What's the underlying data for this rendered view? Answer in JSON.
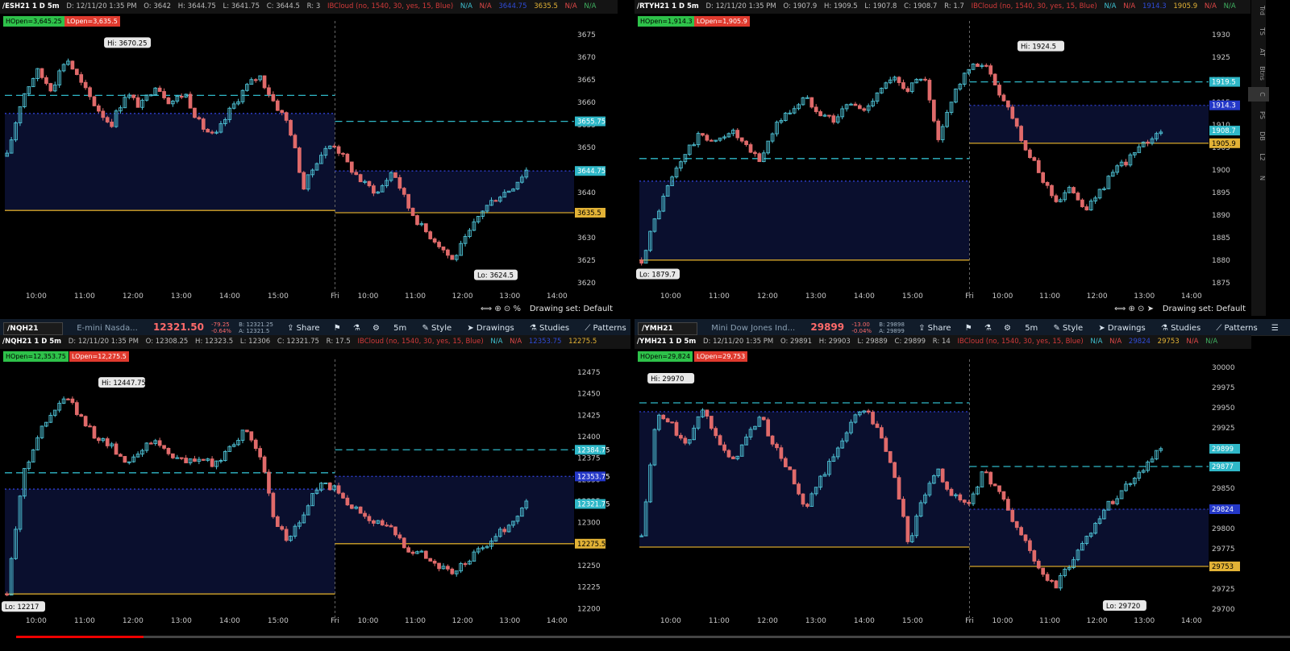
{
  "panels": [
    {
      "id": "es",
      "symbol": "/ESH21 1 D 5m",
      "header_stats": [
        "D: 12/11/20 1:35 PM",
        "O: 3642",
        "H: 3644.75",
        "L: 3641.75",
        "C: 3644.5",
        "R: 3"
      ],
      "study_text": "IBCloud (no, 1540, 30, yes, 15, Blue)",
      "na_labels": [
        "N/A",
        "N/A",
        "N/A",
        "3635.5",
        "N/A",
        "N/A"
      ],
      "hopen": "HOpen=3,645.25",
      "lopen": "LOpen=3,635.5",
      "hi_label": "Hi: 3670.25",
      "lo_label": "Lo: 3624.5",
      "price_labels": [
        "3655.75",
        "3644.75",
        "3635.5"
      ],
      "footer": "Drawing set: Default",
      "chart_data": {
        "type": "candlestick",
        "ylim": [
          3618,
          3678
        ],
        "y_ticks": [
          3620,
          3625,
          3630,
          3635,
          3640,
          3645,
          3650,
          3655,
          3660,
          3665,
          3670,
          3675
        ],
        "x_ticks": [
          "10:00",
          "11:00",
          "12:00",
          "13:00",
          "14:00",
          "15:00",
          "Fri",
          "10:00",
          "11:00",
          "12:00",
          "13:00",
          "14:00"
        ],
        "day_split_fraction": 0.58,
        "path": [
          3648,
          3661,
          3667,
          3663,
          3670,
          3664,
          3659,
          3655,
          3662,
          3659,
          3664,
          3660,
          3662,
          3655,
          3652,
          3658,
          3663,
          3666,
          3660,
          3655,
          3641,
          3648,
          3651,
          3646,
          3642,
          3640,
          3645,
          3637,
          3632,
          3629,
          3625,
          3630,
          3636,
          3639,
          3641,
          3645
        ],
        "last_bar_fraction": 0.92,
        "levels": [
          {
            "value": 3661.5,
            "to": 0.58,
            "color": "#2fb8c8",
            "style": "dash"
          },
          {
            "value": 3655.75,
            "from": 0.58,
            "color": "#2fb8c8",
            "style": "dash"
          },
          {
            "value": 3644.75,
            "from": 0.58,
            "color": "#2f3fd0",
            "style": "dot"
          },
          {
            "value": 3657.5,
            "to": 0.58,
            "color": "#2f3fd0",
            "style": "dot"
          },
          {
            "value": 3636,
            "to": 0.58,
            "color": "#d4a52a",
            "style": "solid"
          },
          {
            "value": 3635.5,
            "from": 0.58,
            "color": "#d4a52a",
            "style": "solid"
          }
        ],
        "price_boxes": [
          {
            "value": 3655.75,
            "bg": "#2fb8c8",
            "fg": "#fff"
          },
          {
            "value": 3644.75,
            "bg": "#2fb8c8",
            "fg": "#fff"
          },
          {
            "value": 3635.5,
            "bg": "#e2b236",
            "fg": "#000"
          }
        ],
        "hi": {
          "value": 3670.25,
          "at": 0.18
        },
        "lo": {
          "value": 3624.5,
          "at": 0.83
        }
      }
    },
    {
      "id": "rty",
      "symbol": "/RTYH21 1 D 5m",
      "header_stats": [
        "D: 12/11/20 1:35 PM",
        "O: 1907.9",
        "H: 1909.5",
        "L: 1907.8",
        "C: 1908.7",
        "R: 1.7"
      ],
      "study_text": "IBCloud (no, 1540, 30, yes, 15, Blue)",
      "na_labels": [
        "N/A",
        "N/A",
        "N/A",
        "1905.9",
        "N/A",
        "N/A"
      ],
      "hopen": "HOpen=1,914.3",
      "lopen": "LOpen=1,905.9",
      "hi_label": "Hi: 1924.5",
      "lo_label": "Lo: 1879.7",
      "price_labels": [
        "1919.5",
        "1914.3",
        "1908.7",
        "1905.9"
      ],
      "footer": "Drawing set: Default",
      "chart_data": {
        "type": "candlestick",
        "ylim": [
          1873,
          1933
        ],
        "y_ticks": [
          1875,
          1880,
          1885,
          1890,
          1895,
          1900,
          1905,
          1910,
          1915,
          1920,
          1925,
          1930
        ],
        "x_ticks": [
          "10:00",
          "11:00",
          "12:00",
          "13:00",
          "14:00",
          "15:00",
          "Fri",
          "10:00",
          "11:00",
          "12:00",
          "13:00",
          "14:00"
        ],
        "day_split_fraction": 0.58,
        "path": [
          1880,
          1890,
          1898,
          1904,
          1908,
          1906,
          1909,
          1905,
          1902,
          1910,
          1913,
          1916,
          1913,
          1911,
          1915,
          1913,
          1918,
          1920,
          1918,
          1921,
          1906,
          1917,
          1922,
          1924,
          1918,
          1912,
          1904,
          1898,
          1893,
          1896,
          1891,
          1896,
          1900,
          1903,
          1906,
          1909
        ],
        "last_bar_fraction": 0.92,
        "levels": [
          {
            "value": 1902.5,
            "to": 0.58,
            "color": "#2fb8c8",
            "style": "dash"
          },
          {
            "value": 1919.5,
            "from": 0.58,
            "color": "#2fb8c8",
            "style": "dash"
          },
          {
            "value": 1914.3,
            "from": 0.58,
            "color": "#2f3fd0",
            "style": "dot"
          },
          {
            "value": 1897.5,
            "to": 0.58,
            "color": "#2f3fd0",
            "style": "dot"
          },
          {
            "value": 1880,
            "to": 0.58,
            "color": "#d4a52a",
            "style": "solid"
          },
          {
            "value": 1905.9,
            "from": 0.58,
            "color": "#d4a52a",
            "style": "solid"
          }
        ],
        "price_boxes": [
          {
            "value": 1919.5,
            "bg": "#2fb8c8",
            "fg": "#fff"
          },
          {
            "value": 1914.3,
            "bg": "#2438c8",
            "fg": "#fff"
          },
          {
            "value": 1908.7,
            "bg": "#2fb8c8",
            "fg": "#fff"
          },
          {
            "value": 1905.9,
            "bg": "#e2b236",
            "fg": "#000"
          }
        ],
        "hi": {
          "value": 1924.5,
          "at": 0.67
        },
        "lo": {
          "value": 1879.7,
          "at": 0.0
        }
      }
    },
    {
      "id": "nq",
      "toolbar": {
        "symbol": "/NQH21",
        "desc": "E-mini Nasda...",
        "price": "12321.50",
        "change_a": "-79.25",
        "change_b": "-0.64%",
        "bid": "B: 12321.25",
        "ask": "A: 12321.5"
      },
      "symbol": "/NQH21 1 D 5m",
      "header_stats": [
        "D: 12/11/20 1:35 PM",
        "O: 12308.25",
        "H: 12323.5",
        "L: 12306",
        "C: 12321.75",
        "R: 17.5"
      ],
      "study_text": "IBCloud (no, 1540, 30, yes, 15, Blue)",
      "na_labels": [
        "N/A",
        "N/A",
        "N/A",
        "12275.5",
        "",
        ""
      ],
      "hopen": "HOpen=12,353.75",
      "lopen": "LOpen=12,275.5",
      "hi_label": "Hi: 12447.75",
      "lo_label": "Lo: 12217",
      "price_labels": [
        "12384.75",
        "12353.75",
        "12321.75",
        "12275.5"
      ],
      "chart_data": {
        "type": "candlestick",
        "ylim": [
          12190,
          12490
        ],
        "y_ticks": [
          12200,
          12225,
          12250,
          12275,
          12300,
          12325,
          12350,
          12375,
          12400,
          12425,
          12450,
          12475
        ],
        "x_ticks": [
          "10:00",
          "11:00",
          "12:00",
          "13:00",
          "14:00",
          "15:00",
          "Fri",
          "10:00",
          "11:00",
          "12:00",
          "13:00",
          "14:00"
        ],
        "day_split_fraction": 0.58,
        "path": [
          12217,
          12350,
          12400,
          12425,
          12447,
          12420,
          12400,
          12390,
          12370,
          12385,
          12395,
          12380,
          12370,
          12375,
          12365,
          12390,
          12405,
          12385,
          12300,
          12280,
          12310,
          12345,
          12340,
          12320,
          12310,
          12300,
          12290,
          12270,
          12265,
          12250,
          12240,
          12255,
          12270,
          12285,
          12300,
          12322
        ],
        "last_bar_fraction": 0.92,
        "levels": [
          {
            "value": 12358,
            "to": 0.58,
            "color": "#2fb8c8",
            "style": "dash"
          },
          {
            "value": 12384.75,
            "from": 0.58,
            "color": "#2fb8c8",
            "style": "dash"
          },
          {
            "value": 12353.75,
            "from": 0.58,
            "color": "#2f3fd0",
            "style": "dot"
          },
          {
            "value": 12339,
            "to": 0.58,
            "color": "#2f3fd0",
            "style": "dot"
          },
          {
            "value": 12217,
            "to": 0.58,
            "color": "#d4a52a",
            "style": "solid"
          },
          {
            "value": 12275.5,
            "from": 0.58,
            "color": "#d4a52a",
            "style": "solid"
          }
        ],
        "price_boxes": [
          {
            "value": 12384.75,
            "bg": "#2fb8c8",
            "fg": "#fff"
          },
          {
            "value": 12353.75,
            "bg": "#2438c8",
            "fg": "#fff"
          },
          {
            "value": 12321.75,
            "bg": "#2fb8c8",
            "fg": "#fff"
          },
          {
            "value": 12275.5,
            "bg": "#e2b236",
            "fg": "#000"
          }
        ],
        "hi": {
          "value": 12447.75,
          "at": 0.17
        },
        "lo": {
          "value": 12217,
          "at": 0.0
        }
      }
    },
    {
      "id": "ym",
      "toolbar": {
        "symbol": "/YMH21",
        "desc": "Mini Dow Jones Ind...",
        "price": "29899",
        "change_a": "-13.00",
        "change_b": "-0.04%",
        "bid": "B: 29898",
        "ask": "A: 29899"
      },
      "symbol": "/YMH21 1 D 5m",
      "header_stats": [
        "D: 12/11/20 1:35 PM",
        "O: 29891",
        "H: 29903",
        "L: 29889",
        "C: 29899",
        "R: 14"
      ],
      "study_text": "IBCloud (no, 1540, 30, yes, 15, Blue)",
      "na_labels": [
        "N/A",
        "N/A",
        "N/A",
        "29753",
        "N/A",
        "N/A"
      ],
      "hopen": "HOpen=29,824",
      "lopen": "LOpen=29,753",
      "hi_label": "Hi: 29970",
      "lo_label": "Lo: 29720",
      "price_labels": [
        "29899",
        "29877",
        "29824",
        "29753"
      ],
      "chart_data": {
        "type": "candlestick",
        "ylim": [
          29690,
          30010
        ],
        "y_ticks": [
          29700,
          29725,
          29750,
          29775,
          29800,
          29825,
          29850,
          29875,
          29900,
          29925,
          29950,
          29975,
          30000
        ],
        "x_ticks": [
          "10:00",
          "11:00",
          "12:00",
          "13:00",
          "14:00",
          "15:00",
          "Fri",
          "10:00",
          "11:00",
          "12:00",
          "13:00",
          "14:00"
        ],
        "day_split_fraction": 0.58,
        "path": [
          29790,
          29940,
          29930,
          29900,
          29950,
          29920,
          29880,
          29910,
          29940,
          29900,
          29870,
          29820,
          29860,
          29890,
          29930,
          29950,
          29920,
          29870,
          29780,
          29840,
          29870,
          29840,
          29830,
          29870,
          29850,
          29810,
          29780,
          29740,
          29730,
          29760,
          29790,
          29820,
          29840,
          29860,
          29880,
          29899
        ],
        "last_bar_fraction": 0.92,
        "levels": [
          {
            "value": 29956,
            "to": 0.58,
            "color": "#2fb8c8",
            "style": "dash"
          },
          {
            "value": 29877,
            "from": 0.58,
            "color": "#2fb8c8",
            "style": "dash"
          },
          {
            "value": 29824,
            "from": 0.58,
            "color": "#2f3fd0",
            "style": "dot"
          },
          {
            "value": 29945,
            "to": 0.58,
            "color": "#2f3fd0",
            "style": "dot"
          },
          {
            "value": 29777,
            "to": 0.58,
            "color": "#d4a52a",
            "style": "solid"
          },
          {
            "value": 29753,
            "from": 0.58,
            "color": "#d4a52a",
            "style": "solid"
          }
        ],
        "price_boxes": [
          {
            "value": 29899,
            "bg": "#2fb8c8",
            "fg": "#fff"
          },
          {
            "value": 29877,
            "bg": "#2fb8c8",
            "fg": "#fff"
          },
          {
            "value": 29824,
            "bg": "#2438c8",
            "fg": "#fff"
          },
          {
            "value": 29753,
            "bg": "#e2b236",
            "fg": "#000"
          }
        ],
        "hi": {
          "value": 29970,
          "at": 0.02
        },
        "lo": {
          "value": 29720,
          "at": 0.82
        }
      }
    }
  ],
  "toolbar_buttons": {
    "share": "Share",
    "timeframe": "5m",
    "style": "Style",
    "drawings": "Drawings",
    "studies": "Studies",
    "patterns": "Patterns"
  },
  "side_tabs": [
    "Trd",
    "TS",
    "AT",
    "Btns",
    "C",
    "PS",
    "DB",
    "L2",
    "N"
  ],
  "video_progress": 0.1
}
